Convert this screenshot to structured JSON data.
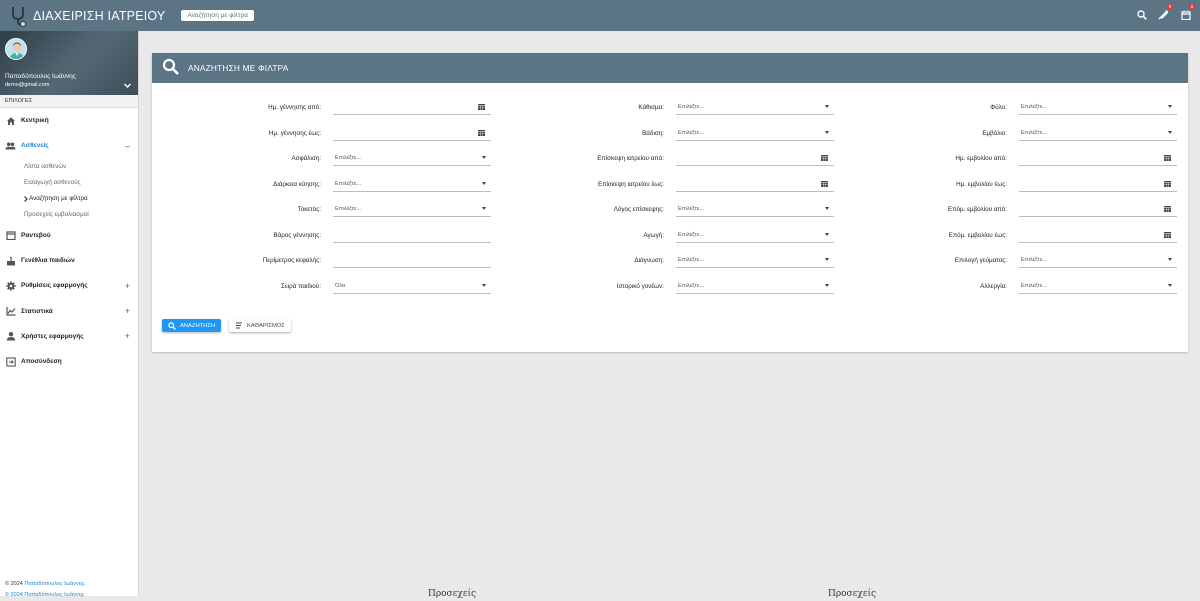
{
  "header": {
    "title": "ΔΙΑΧΕΙΡΙΣΗ ΙΑΤΡΕΙΟΥ",
    "breadcrumb": "Αναζήτηση με φίλτρα",
    "icons": [
      "search-icon",
      "syringe-icon",
      "calendar-icon"
    ],
    "badges": {
      "syringe": "0",
      "calendar": "0"
    }
  },
  "profile": {
    "name": "Παπαδόπουλος Ιωάννης",
    "email": "demo@gmail.com"
  },
  "sidebar": {
    "section": "ΕΠΙΛΟΓΕΣ",
    "items": [
      {
        "label": "Κεντρική",
        "icon": "home-icon"
      },
      {
        "label": "Ασθενείς",
        "icon": "people-icon",
        "toggle": "–"
      },
      {
        "label": "Ραντεβού",
        "icon": "calendar-icon"
      },
      {
        "label": "Γενέθλια παιδιών",
        "icon": "cake-icon"
      },
      {
        "label": "Ρυθμίσεις εφαρμογής",
        "icon": "gear-icon",
        "toggle": "+"
      },
      {
        "label": "Στατιστικά",
        "icon": "chart-icon",
        "toggle": "+"
      },
      {
        "label": "Χρήστες εφαρμογής",
        "icon": "person-icon",
        "toggle": "+"
      },
      {
        "label": "Αποσύνδεση",
        "icon": "logout-icon"
      }
    ],
    "sub_items": [
      "Λίστα ασθενών",
      "Εισαγωγή ασθενούς",
      "Αναζήτηση με φίλτρα",
      "Προσεχείς εμβολιασμοί"
    ]
  },
  "footer": {
    "copyright": "© 2024",
    "author": "Παπαδόπουλος Ιωάννης.",
    "line2": "© 2024 Παπαδόπουλος Ιωάννης"
  },
  "card": {
    "title": "ΑΝΑΖΗΤΗΣΗ ΜΕ ΦΙΛΤΡΑ"
  },
  "filters": {
    "col1": [
      {
        "label": "Ημ. γέννησης από:",
        "type": "date",
        "value": ""
      },
      {
        "label": "Ημ. γέννησης έως:",
        "type": "date",
        "value": ""
      },
      {
        "label": "Ασφάλιση:",
        "type": "select",
        "value": "Επιλέξτε..."
      },
      {
        "label": "Διάρκεια κύησης:",
        "type": "select",
        "value": "Επιλέξτε..."
      },
      {
        "label": "Τοκετός:",
        "type": "select",
        "value": "Επιλέξτε..."
      },
      {
        "label": "Βάρος γέννησης:",
        "type": "text",
        "value": ""
      },
      {
        "label": "Περίμετρος κεφαλής:",
        "type": "text",
        "value": ""
      },
      {
        "label": "Σειρά παιδιού:",
        "type": "select",
        "value": "Όλα"
      }
    ],
    "col2": [
      {
        "label": "Κάθισμα:",
        "type": "select",
        "value": "Επιλέξτε..."
      },
      {
        "label": "Βάδιση:",
        "type": "select",
        "value": "Επιλέξτε..."
      },
      {
        "label": "Επίσκεψη ιατρείου από:",
        "type": "date",
        "value": ""
      },
      {
        "label": "Επίσκεψη ιατρείου έως:",
        "type": "date",
        "value": ""
      },
      {
        "label": "Λόγος επίσκεψης:",
        "type": "select",
        "value": "Επιλέξτε..."
      },
      {
        "label": "Αγωγή:",
        "type": "select",
        "value": "Επιλέξτε..."
      },
      {
        "label": "Διάγνωση:",
        "type": "select",
        "value": "Επιλέξτε..."
      },
      {
        "label": "Ιστορικό γονέων:",
        "type": "select",
        "value": "Επιλέξτε..."
      }
    ],
    "col3": [
      {
        "label": "Φύλο:",
        "type": "select",
        "value": "Επιλέξτε..."
      },
      {
        "label": "Εμβόλιο:",
        "type": "select",
        "value": "Επιλέξτε..."
      },
      {
        "label": "Ημ. εμβολίου από:",
        "type": "date",
        "value": ""
      },
      {
        "label": "Ημ. εμβολίου έως:",
        "type": "date",
        "value": ""
      },
      {
        "label": "Επόμ. εμβολίου από:",
        "type": "date",
        "value": ""
      },
      {
        "label": "Επόμ. εμβολίου έως:",
        "type": "date",
        "value": ""
      },
      {
        "label": "Επιλογή γεύματος:",
        "type": "select",
        "value": "Επιλέξτε..."
      },
      {
        "label": "Αλλεργία:",
        "type": "select",
        "value": "Επιλέξτε..."
      }
    ]
  },
  "actions": {
    "search": "ΑΝΑΖΗΤΗΣΗ",
    "clear": "ΚΑΘΑΡΙΣΜΟΣ"
  },
  "background_text": [
    "Προσεχείς",
    "Προσεχείς"
  ]
}
